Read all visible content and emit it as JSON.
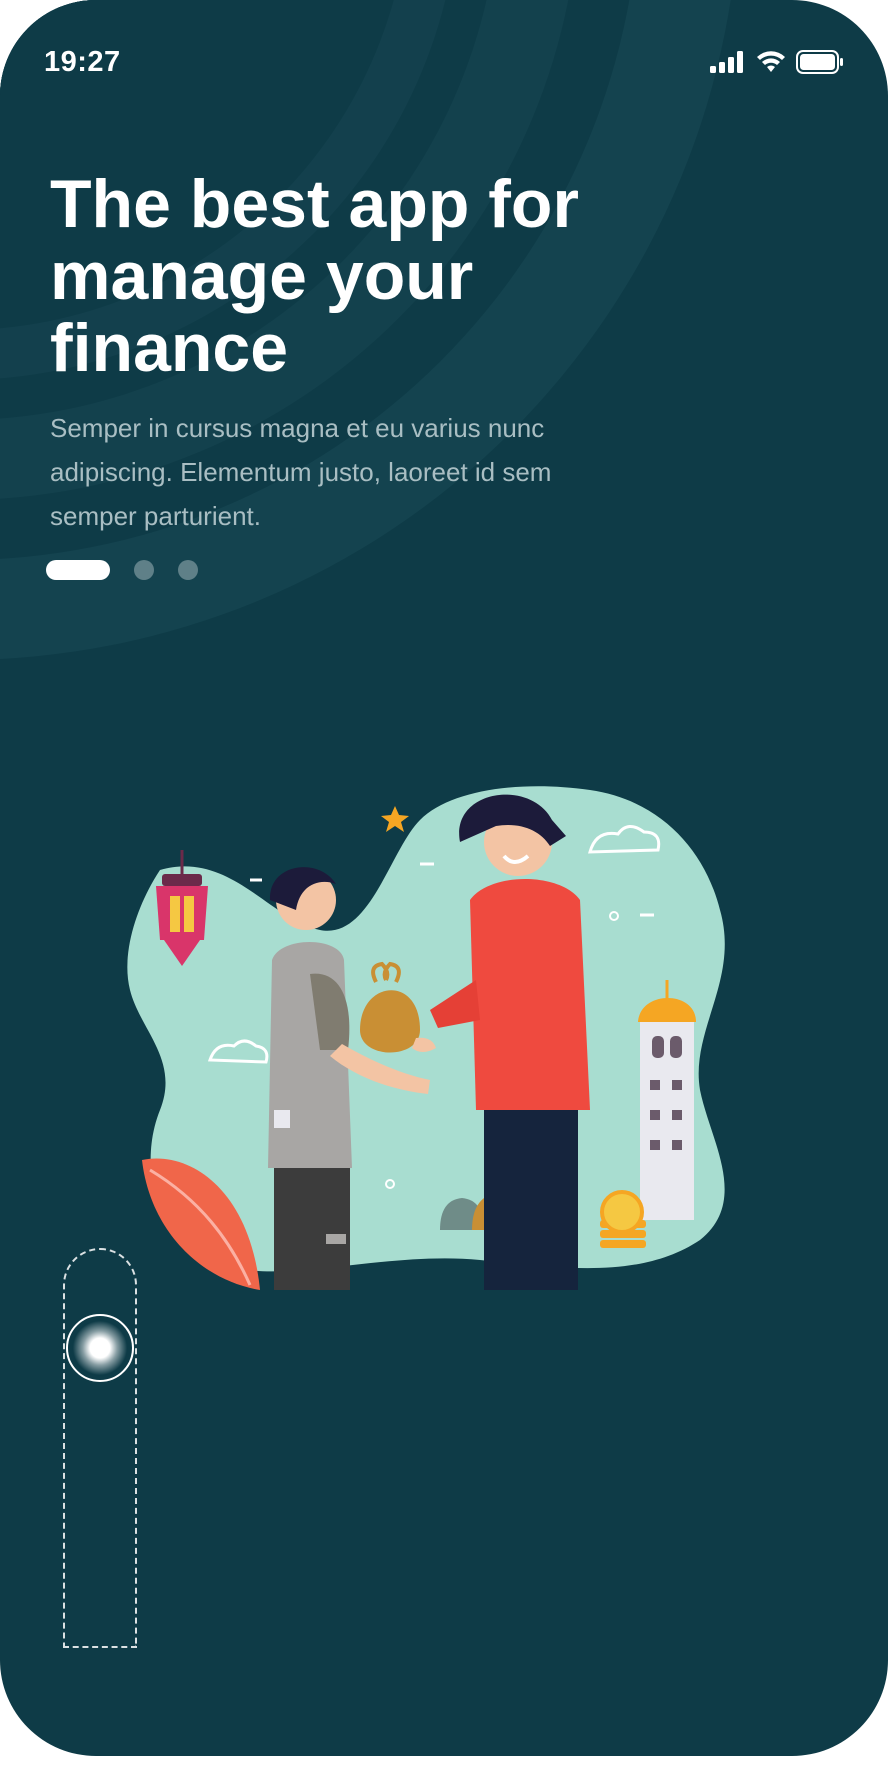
{
  "status_bar": {
    "time": "19:27",
    "icons": [
      "signal-icon",
      "wifi-icon",
      "battery-icon"
    ]
  },
  "hero": {
    "title": "The best app for manage your finance",
    "subtitle": "Semper in cursus magna et eu varius nunc adipiscing. Elementum justo, laoreet id sem semper parturient."
  },
  "pager": {
    "total": 3,
    "active_index": 0
  },
  "illustration": {
    "name": "people-exchanging-gift-illustration"
  },
  "colors": {
    "background": "#0e3b47",
    "blob": "#a8ddd0",
    "accent_red": "#ef4a3f",
    "accent_gold": "#f5a623",
    "text_primary": "#ffffff",
    "text_secondary": "#a9bec3"
  }
}
